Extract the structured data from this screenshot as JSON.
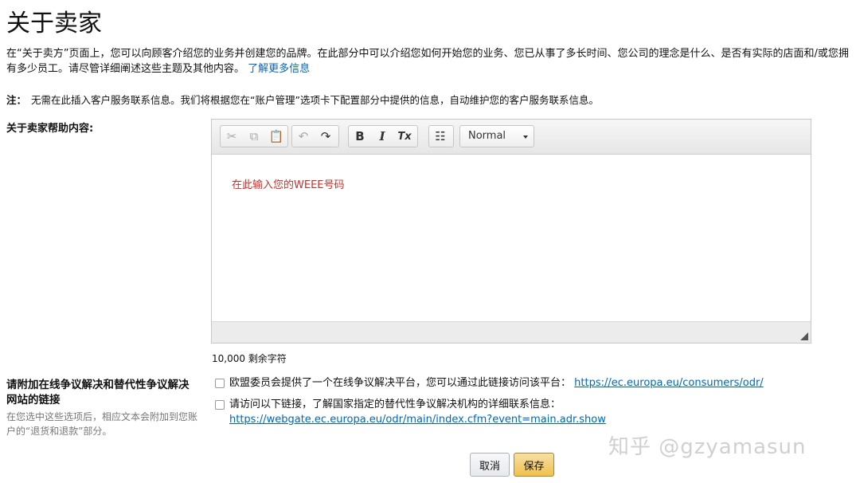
{
  "page": {
    "title": "关于卖家",
    "intro": "在“关于卖方”页面上，您可以向顾客介绍您的业务并创建您的品牌。在此部分中可以介绍您如何开始您的业务、您已从事了多长时间、您公司的理念是什么、是否有实际的店面和/或您拥有多少员工。请尽管详细阐述这些主题及其他内容。",
    "learn_more": "了解更多信息",
    "note_label": "注：",
    "note_text": "无需在此插入客户服务联系信息。我们将根据您在“账户管理”选项卡下配置部分中提供的信息，自动维护您的客户服务联系信息。"
  },
  "editor": {
    "label": "关于卖家帮助内容:",
    "toolbar": {
      "cut": "✂",
      "copy": "⧉",
      "paste": "📋",
      "undo": "↶",
      "redo": "↷",
      "bold": "B",
      "italic": "I",
      "remove_format": "Tx",
      "list": "☷",
      "format_value": "Normal"
    },
    "content": "在此输入您的WEEE号码",
    "remaining": "10,000 剩余字符"
  },
  "odr": {
    "label": "请附加在线争议解决和替代性争议解决网站的链接",
    "help": "在您选中这些选项后，相应文本会附加到您账户的“退货和退款”部分。",
    "option1_text": "欧盟委员会提供了一个在线争议解决平台，您可以通过此链接访问该平台：",
    "option1_link": "https://ec.europa.eu/consumers/odr/",
    "option2_text": "请访问以下链接，了解国家指定的替代性争议解决机构的详细联系信息：",
    "option2_link": "https://webgate.ec.europa.eu/odr/main/index.cfm?event=main.adr.show"
  },
  "actions": {
    "cancel": "取消",
    "save": "保存"
  },
  "watermark": "知乎 @gzyamasun"
}
